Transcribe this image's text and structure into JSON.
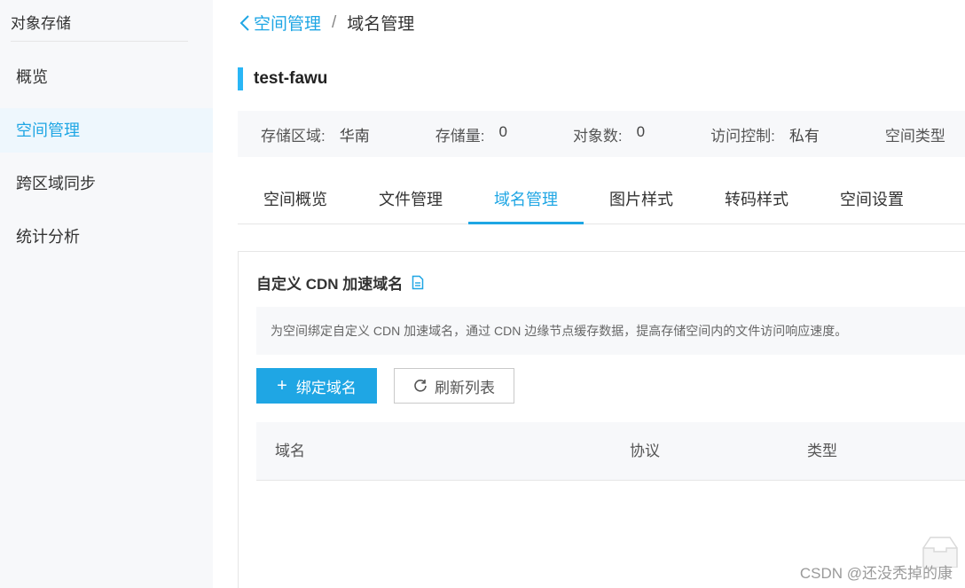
{
  "sidebar": {
    "title": "对象存储",
    "items": [
      {
        "label": "概览"
      },
      {
        "label": "空间管理"
      },
      {
        "label": "跨区域同步"
      },
      {
        "label": "统计分析"
      }
    ]
  },
  "breadcrumb": {
    "back_label": "空间管理",
    "separator": "/",
    "current": "域名管理"
  },
  "bucket": {
    "name": "test-fawu"
  },
  "info": {
    "region_label": "存储区域:",
    "region_value": "华南",
    "storage_label": "存储量:",
    "storage_value": "0",
    "objects_label": "对象数:",
    "objects_value": "0",
    "access_label": "访问控制:",
    "access_value": "私有",
    "type_label": "空间类型"
  },
  "tabs": [
    {
      "label": "空间概览"
    },
    {
      "label": "文件管理"
    },
    {
      "label": "域名管理"
    },
    {
      "label": "图片样式"
    },
    {
      "label": "转码样式"
    },
    {
      "label": "空间设置"
    }
  ],
  "panel": {
    "title": "自定义 CDN 加速域名",
    "notice": "为空间绑定自定义 CDN 加速域名，通过 CDN 边缘节点缓存数据，提高存储空间内的文件访问响应速度。",
    "bind_button": "绑定域名",
    "refresh_button": "刷新列表",
    "columns": [
      "域名",
      "协议",
      "类型"
    ]
  },
  "watermark": "CSDN @还没秃掉的康",
  "colors": {
    "accent": "#1fa6e4",
    "bucket_bar": "#29b6f6",
    "sidebar_bg": "#f7f8fa",
    "active_nav_bg": "#eef7fd"
  }
}
